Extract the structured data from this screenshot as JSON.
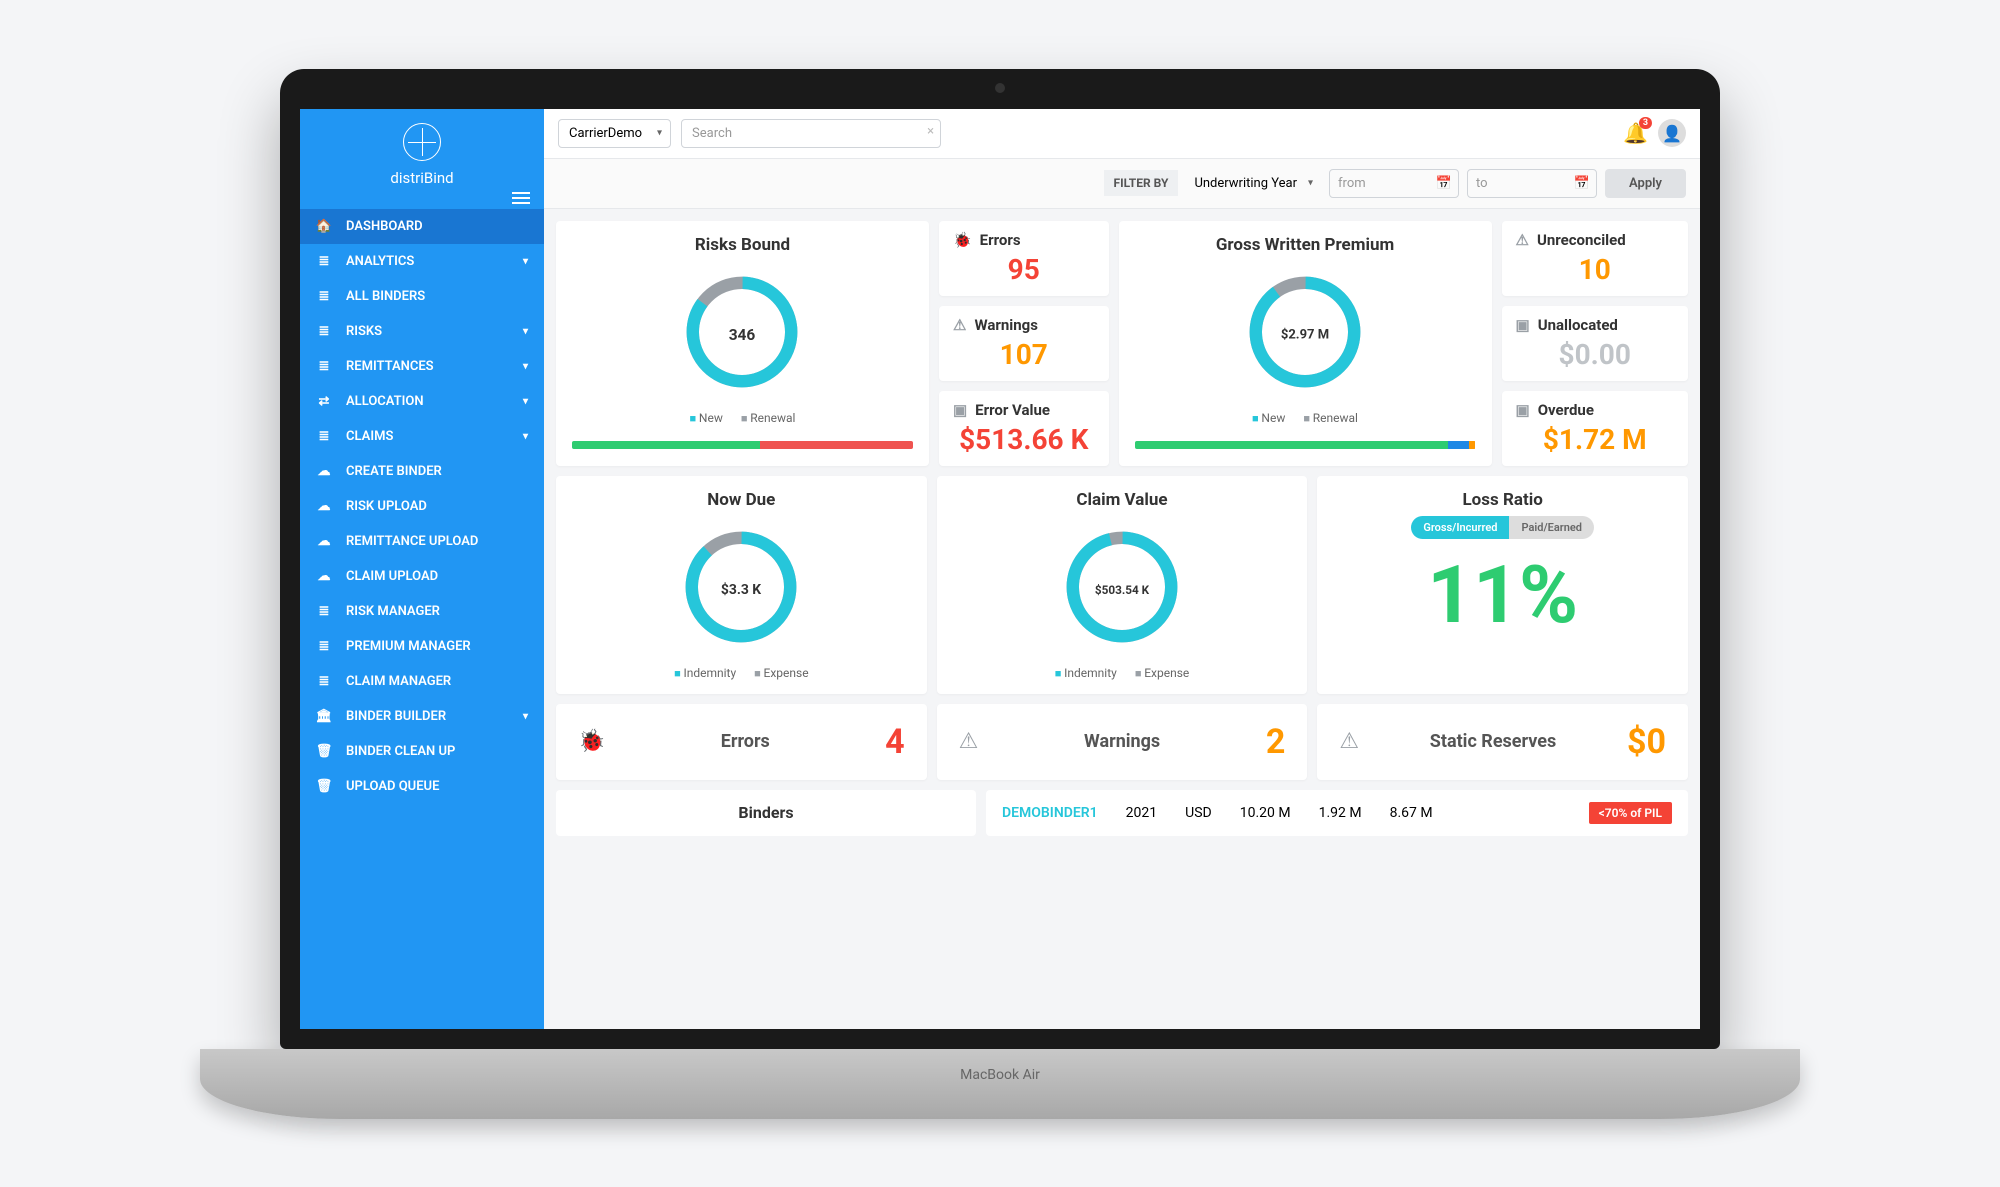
{
  "brand": "distriBind",
  "base_label": "MacBook Air",
  "sidebar": {
    "items": [
      {
        "label": "DASHBOARD",
        "icon": "🏠",
        "active": true
      },
      {
        "label": "ANALYTICS",
        "icon": "≣",
        "expand": true
      },
      {
        "label": "ALL BINDERS",
        "icon": "≣"
      },
      {
        "label": "RISKS",
        "icon": "≣",
        "expand": true
      },
      {
        "label": "REMITTANCES",
        "icon": "≣",
        "expand": true
      },
      {
        "label": "ALLOCATION",
        "icon": "⇄",
        "expand": true
      },
      {
        "label": "CLAIMS",
        "icon": "≣",
        "expand": true
      },
      {
        "label": "CREATE BINDER",
        "icon": "☁"
      },
      {
        "label": "RISK UPLOAD",
        "icon": "☁"
      },
      {
        "label": "REMITTANCE UPLOAD",
        "icon": "☁"
      },
      {
        "label": "CLAIM UPLOAD",
        "icon": "☁"
      },
      {
        "label": "RISK MANAGER",
        "icon": "≣"
      },
      {
        "label": "PREMIUM MANAGER",
        "icon": "≣"
      },
      {
        "label": "CLAIM MANAGER",
        "icon": "≣"
      },
      {
        "label": "BINDER BUILDER",
        "icon": "🏛",
        "expand": true
      },
      {
        "label": "BINDER CLEAN UP",
        "icon": "🗑"
      },
      {
        "label": "UPLOAD QUEUE",
        "icon": "🗑"
      }
    ]
  },
  "topbar": {
    "tenant": "CarrierDemo",
    "search_placeholder": "Search",
    "notif_count": "3"
  },
  "filter": {
    "label": "FILTER BY",
    "selector": "Underwriting Year",
    "from": "from",
    "to": "to",
    "apply": "Apply"
  },
  "cards": {
    "risks": {
      "title": "Risks Bound",
      "value": "346",
      "legend": [
        "New",
        "Renewal"
      ]
    },
    "errors": {
      "label": "Errors",
      "value": "95",
      "icon": "🐞"
    },
    "warnings": {
      "label": "Warnings",
      "value": "107",
      "icon": "⚠"
    },
    "error_value": {
      "label": "Error Value",
      "value": "$513.66 K",
      "icon": "▣"
    },
    "gwp": {
      "title": "Gross Written Premium",
      "value": "$2.97 M",
      "legend": [
        "New",
        "Renewal"
      ]
    },
    "unreconciled": {
      "label": "Unreconciled",
      "value": "10",
      "icon": "⚠"
    },
    "unallocated": {
      "label": "Unallocated",
      "value": "$0.00",
      "icon": "▣"
    },
    "overdue": {
      "label": "Overdue",
      "value": "$1.72 M",
      "icon": "▣"
    },
    "now_due": {
      "title": "Now Due",
      "value": "$3.3 K",
      "legend": [
        "Indemnity",
        "Expense"
      ]
    },
    "claim_value": {
      "title": "Claim Value",
      "value": "$503.54 K",
      "legend": [
        "Indemnity",
        "Expense"
      ]
    },
    "loss_ratio": {
      "title": "Loss Ratio",
      "value": "11%",
      "toggle": [
        "Gross/Incurred",
        "Paid/Earned"
      ]
    },
    "s_errors": {
      "label": "Errors",
      "value": "4"
    },
    "s_warnings": {
      "label": "Warnings",
      "value": "2"
    },
    "s_reserves": {
      "label": "Static Reserves",
      "value": "$0"
    }
  },
  "binders": {
    "title": "Binders",
    "row": {
      "name": "DEMOBINDER1",
      "year": "2021",
      "ccy": "USD",
      "c1": "10.20 M",
      "c2": "1.92 M",
      "c3": "8.67 M",
      "pill": "<70% of PIL"
    }
  },
  "chart_data": [
    {
      "type": "pie",
      "title": "Risks Bound",
      "series": [
        {
          "name": "New",
          "value": 85,
          "color": "#26c6da"
        },
        {
          "name": "Renewal",
          "value": 15,
          "color": "#9aa0a6"
        }
      ],
      "center_label": "346"
    },
    {
      "type": "pie",
      "title": "Gross Written Premium",
      "series": [
        {
          "name": "New",
          "value": 90,
          "color": "#26c6da"
        },
        {
          "name": "Renewal",
          "value": 10,
          "color": "#9aa0a6"
        }
      ],
      "center_label": "$2.97 M"
    },
    {
      "type": "pie",
      "title": "Now Due",
      "series": [
        {
          "name": "Indemnity",
          "value": 88,
          "color": "#26c6da"
        },
        {
          "name": "Expense",
          "value": 12,
          "color": "#9aa0a6"
        }
      ],
      "center_label": "$3.3 K"
    },
    {
      "type": "pie",
      "title": "Claim Value",
      "series": [
        {
          "name": "Indemnity",
          "value": 96,
          "color": "#26c6da"
        },
        {
          "name": "Expense",
          "value": 4,
          "color": "#9aa0a6"
        }
      ],
      "center_label": "$503.54 K"
    },
    {
      "type": "bar",
      "title": "Risks Bound bar",
      "segments": [
        {
          "color": "#2ecc71",
          "pct": 55
        },
        {
          "color": "#ef5350",
          "pct": 45
        }
      ]
    },
    {
      "type": "bar",
      "title": "GWP bar",
      "segments": [
        {
          "color": "#2ecc71",
          "pct": 92
        },
        {
          "color": "#1e88e5",
          "pct": 6
        },
        {
          "color": "#ff9800",
          "pct": 2
        }
      ]
    }
  ],
  "colors": {
    "primary": "#2196f3",
    "teal": "#26c6da",
    "red": "#f44336",
    "amber": "#ff9800",
    "green": "#2ecc71",
    "grey": "#9aa0a6"
  }
}
